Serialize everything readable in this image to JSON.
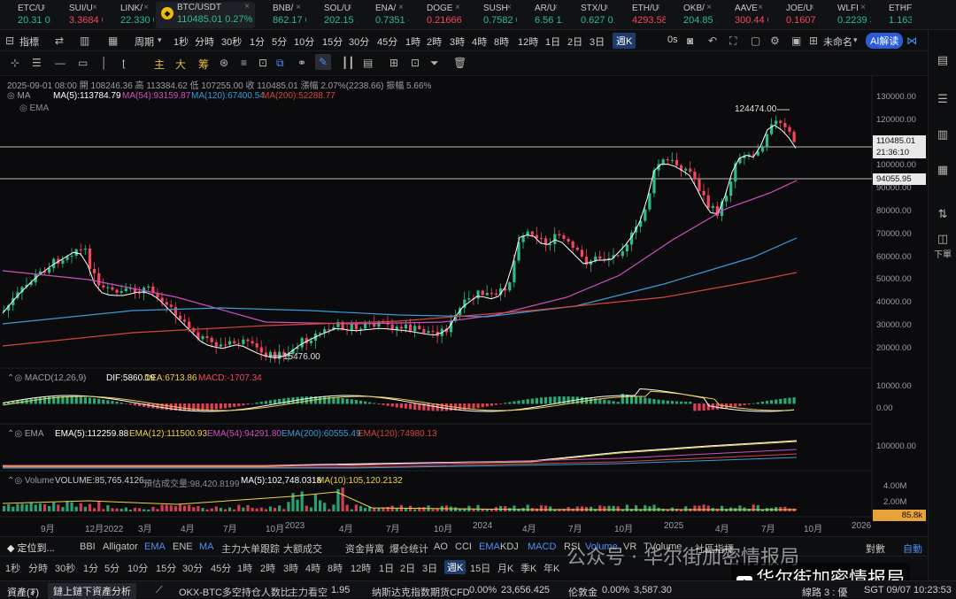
{
  "ticker": [
    {
      "name": "ETC/U",
      "price": "20.31",
      "extra": "0.",
      "dir": "up"
    },
    {
      "name": "SUI/U",
      "price": "3.3684",
      "extra": "0",
      "dir": "dn"
    },
    {
      "name": "LINK/",
      "price": "22.330",
      "extra": "0",
      "dir": "up"
    },
    {
      "name": "BTC/USDT",
      "price": "110485.01",
      "extra": "0.27%",
      "dir": "up",
      "active": true
    },
    {
      "name": "BNB/",
      "price": "862.17",
      "extra": "0",
      "dir": "up"
    },
    {
      "name": "SOL/U",
      "price": "202.15",
      "extra": "1",
      "dir": "up"
    },
    {
      "name": "ENA/",
      "price": "0.7351",
      "extra": "-",
      "dir": "up"
    },
    {
      "name": "DOGE",
      "price": "0.21666",
      "extra": "",
      "dir": "dn"
    },
    {
      "name": "SUSH",
      "price": "0.7582",
      "extra": "0",
      "dir": "up"
    },
    {
      "name": "AR/U",
      "price": "6.56",
      "extra": "1.3",
      "dir": "up"
    },
    {
      "name": "STX/U",
      "price": "0.627",
      "extra": "0.",
      "dir": "up"
    },
    {
      "name": "ETH/U",
      "price": "4293.58",
      "extra": "",
      "dir": "dn"
    },
    {
      "name": "OKB/",
      "price": "204.85",
      "extra": "1",
      "dir": "up"
    },
    {
      "name": "AAVE",
      "price": "300.44",
      "extra": "0",
      "dir": "dn"
    },
    {
      "name": "JOE/U",
      "price": "0.1607",
      "extra": "1",
      "dir": "dn"
    },
    {
      "name": "WLFI",
      "price": "0.2239",
      "extra": "3",
      "dir": "up"
    },
    {
      "name": "ETHF",
      "price": "1.163",
      "extra": "0.",
      "dir": "up"
    }
  ],
  "toolbar1": {
    "indicator": "指標",
    "template": "",
    "period": "周期",
    "intervals": [
      "1秒",
      "分時",
      "30秒",
      "1分",
      "5分",
      "10分",
      "15分",
      "30分",
      "45分",
      "1時",
      "2時",
      "3時",
      "4時",
      "8時",
      "12時",
      "1日",
      "2日",
      "3日",
      "週K"
    ],
    "selected_interval": "週K",
    "countdown": "0s",
    "layout_name": "未命名",
    "ai_label": "AI解读"
  },
  "toolbar2": {
    "labels": [
      "主",
      "大",
      "筹"
    ]
  },
  "chart": {
    "info_line": "2025-09-01 08:00  開 108246.36  高 113384.62  低 107255.00  收 110485.01  漲幅 2.07%(2238.66)  振幅 5.66%",
    "ma_label": "MA",
    "ma5": "MA(5):113784.79",
    "ma54": "MA(54):93159.87",
    "ma120": "MA(120):67400.54",
    "ma200": "MA(200):52288.77",
    "ema_label": "EMA",
    "high_label": "124474.00",
    "low_label": "15476.00",
    "price_tag": "110485.01",
    "countdown_tag": "21:36:10",
    "line_tag": "94055.95",
    "price_axis": [
      "130000.00",
      "120000.00",
      "110000.00",
      "100000.00",
      "90000.00",
      "80000.00",
      "70000.00",
      "60000.00",
      "50000.00",
      "40000.00",
      "30000.00",
      "20000.00"
    ],
    "macd_label": "MACD(12,26,9)",
    "macd_dif": "DIF:5860.19",
    "macd_dea": "DEA:6713.86",
    "macd_val": "MACD:-1707.34",
    "macd_axis": [
      "10000.00",
      "0.00"
    ],
    "ema_panel_label": "EMA",
    "ema5": "EMA(5):112259.88",
    "ema12": "EMA(12):111500.93",
    "ema54": "EMA(54):94291.80",
    "ema200": "EMA(200):60555.49",
    "ema120": "EMA(120):74980.13",
    "ema_axis": [
      "100000.00"
    ],
    "vol_label": "Volume",
    "vol_val": "VOLUME:85,765.4126",
    "vol_est": "預估成交量:98,420.8199",
    "vol_ma5": "MA(5):102,748.0318",
    "vol_ma10": "MA(10):105,120.2132",
    "vol_axis": [
      "4.00M",
      "2.00M"
    ],
    "vol_tag": "85.8k",
    "time_axis": [
      "9月",
      "12月2022",
      "3月",
      "4月",
      "7月",
      "10月",
      "2023",
      "4月",
      "7月",
      "10月",
      "2024",
      "4月",
      "7月",
      "10月",
      "2025",
      "4月",
      "7月",
      "10月",
      "2026"
    ]
  },
  "indicator_bar": {
    "label": "定位到...",
    "items": [
      "BBI",
      "Alligator",
      "EMA",
      "ENE",
      "MA",
      "主力大单跟踪",
      "大额成交",
      "资金背离",
      "爆仓统计",
      "AO",
      "CCI",
      "EMA",
      "KDJ",
      "MACD",
      "RSI",
      "Volume",
      "VR",
      "TVolume",
      "社區指標"
    ],
    "active": [
      "EMA",
      "MA",
      "EMA",
      "MACD",
      "Volume"
    ],
    "right": [
      "對數",
      "自動"
    ]
  },
  "period_bar": {
    "items": [
      "1秒",
      "分時",
      "30秒",
      "1分",
      "5分",
      "10分",
      "15分",
      "30分",
      "45分",
      "1時",
      "2時",
      "3時",
      "4時",
      "8時",
      "12時",
      "1日",
      "2日",
      "3日",
      "週K",
      "15日",
      "月K",
      "季K",
      "年K"
    ],
    "selected": "週K"
  },
  "status_bar": {
    "assets": "資產(₮)",
    "analysis": "鏈上鏈下資產分析",
    "okx_label": "OKX-BTC多空持仓人数比",
    "okx_tag": "主力看空",
    "okx_val": "1.95",
    "nasdaq": "纳斯达克指数期货CFD",
    "nasdaq_pct": "0.00%",
    "nasdaq_val": "23,656.425",
    "gold": "伦敦金",
    "gold_pct": "0.00%",
    "gold_val": "3,587.30",
    "line": "線路 3 : 優",
    "time": "SGT 09/07 10:23:53"
  },
  "right_sidebar": {
    "down_label": "下單"
  },
  "watermark": {
    "line1": "公众号 · 华尔街加密情报局",
    "line2": "华尔街加密情报局"
  },
  "colors": {
    "up": "#2ebd85",
    "down": "#f6465d",
    "ma5": "#ffffff",
    "ma54": "#d14fbf",
    "ma120": "#3a9bd9",
    "ma200": "#d5463c",
    "dif": "#ffffff",
    "dea": "#f0d34a"
  }
}
